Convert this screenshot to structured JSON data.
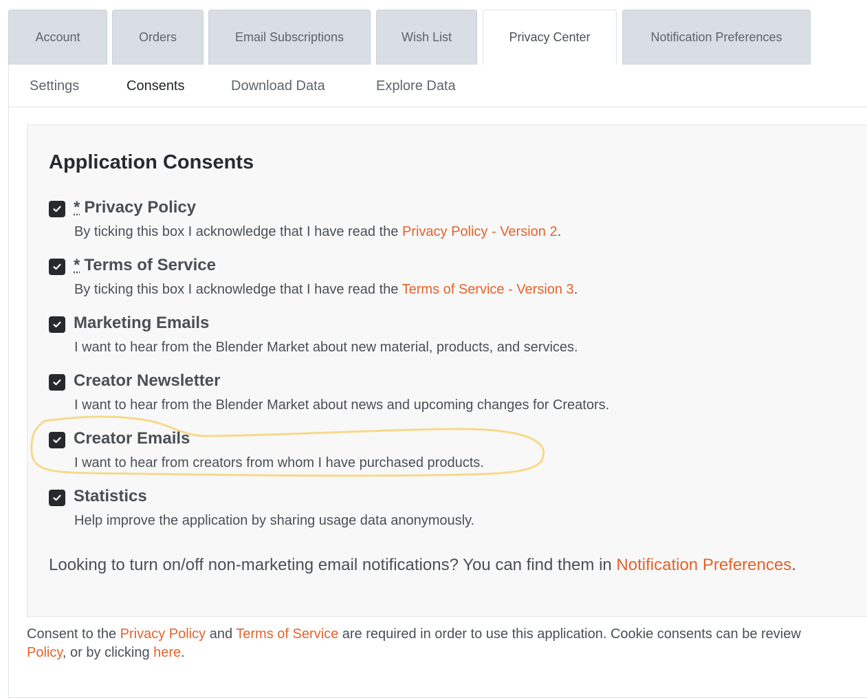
{
  "tabs": [
    {
      "label": "Account"
    },
    {
      "label": "Orders"
    },
    {
      "label": "Email Subscriptions"
    },
    {
      "label": "Wish List"
    },
    {
      "label": "Privacy Center",
      "active": true
    },
    {
      "label": "Notification Preferences"
    }
  ],
  "subnav": [
    {
      "label": "Settings"
    },
    {
      "label": "Consents",
      "active": true
    },
    {
      "label": "Download Data"
    },
    {
      "label": "Explore Data"
    }
  ],
  "card": {
    "title": "Application Consents"
  },
  "consents": [
    {
      "required_mark": "*",
      "title": "Privacy Policy",
      "checked": true,
      "desc_prefix": "By ticking this box I acknowledge that I have read the ",
      "desc_link": "Privacy Policy - Version 2",
      "desc_suffix": "."
    },
    {
      "required_mark": "*",
      "title": "Terms of Service",
      "checked": true,
      "desc_prefix": "By ticking this box I acknowledge that I have read the ",
      "desc_link": "Terms of Service - Version 3",
      "desc_suffix": "."
    },
    {
      "title": "Marketing Emails",
      "checked": true,
      "desc": "I want to hear from the Blender Market about new material, products, and services."
    },
    {
      "title": "Creator Newsletter",
      "checked": true,
      "desc": "I want to hear from the Blender Market about news and upcoming changes for Creators."
    },
    {
      "title": "Creator Emails",
      "checked": true,
      "desc": "I want to hear from creators from whom I have purchased products."
    },
    {
      "title": "Statistics",
      "checked": true,
      "desc": "Help improve the application by sharing usage data anonymously."
    }
  ],
  "notice": {
    "text": "Looking to turn on/off non-marketing email notifications? You can find them in ",
    "link": "Notification Preferences",
    "suffix": "."
  },
  "footer": {
    "p1": "Consent to the ",
    "link1": "Privacy Policy",
    "p2": " and ",
    "link2": "Terms of Service",
    "p3": " are required in order to use this application. Cookie consents can be review",
    "link3": "Policy",
    "p4": ", or by clicking ",
    "link4": "here",
    "p5": "."
  },
  "colors": {
    "accent": "#e3632b",
    "highlight": "#f7d98a",
    "checkbox": "#262a2e"
  }
}
